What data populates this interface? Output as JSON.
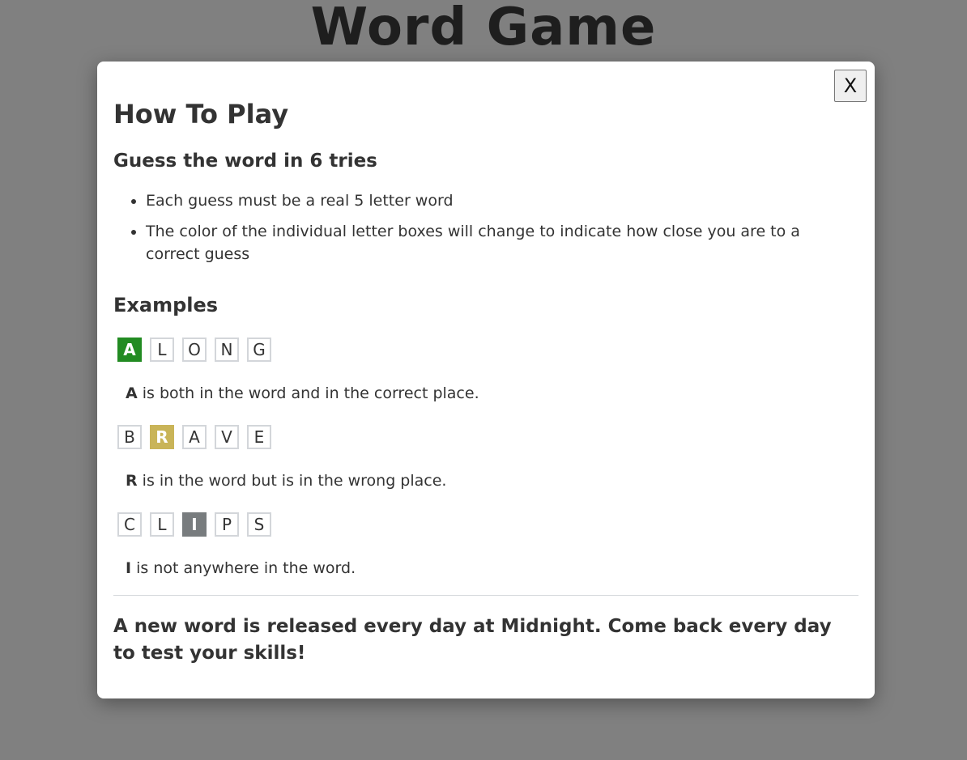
{
  "app": {
    "title": "Word Game"
  },
  "modal": {
    "close_label": "X",
    "heading": "How To Play",
    "subheading": "Guess the word in 6 tries",
    "rules": [
      "Each guess must be a real 5 letter word",
      "The color of the individual letter boxes will change to indicate how close you are to a correct guess"
    ],
    "examples_heading": "Examples",
    "examples": [
      {
        "word": [
          "A",
          "L",
          "O",
          "N",
          "G"
        ],
        "highlight_index": 0,
        "status": "correct",
        "highlight_letter": "A",
        "note": " is both in the word and in the correct place."
      },
      {
        "word": [
          "B",
          "R",
          "A",
          "V",
          "E"
        ],
        "highlight_index": 1,
        "status": "present",
        "highlight_letter": "R",
        "note": " is in the word but is in the wrong place."
      },
      {
        "word": [
          "C",
          "L",
          "I",
          "P",
          "S"
        ],
        "highlight_index": 2,
        "status": "absent",
        "highlight_letter": "I",
        "note": " is not anywhere in the word."
      }
    ],
    "footer": "A new word is released every day at Midnight. Come back every day to test your skills!"
  },
  "colors": {
    "correct": "#228b22",
    "present": "#c9b458",
    "absent": "#787c7e",
    "overlay": "#808080"
  }
}
